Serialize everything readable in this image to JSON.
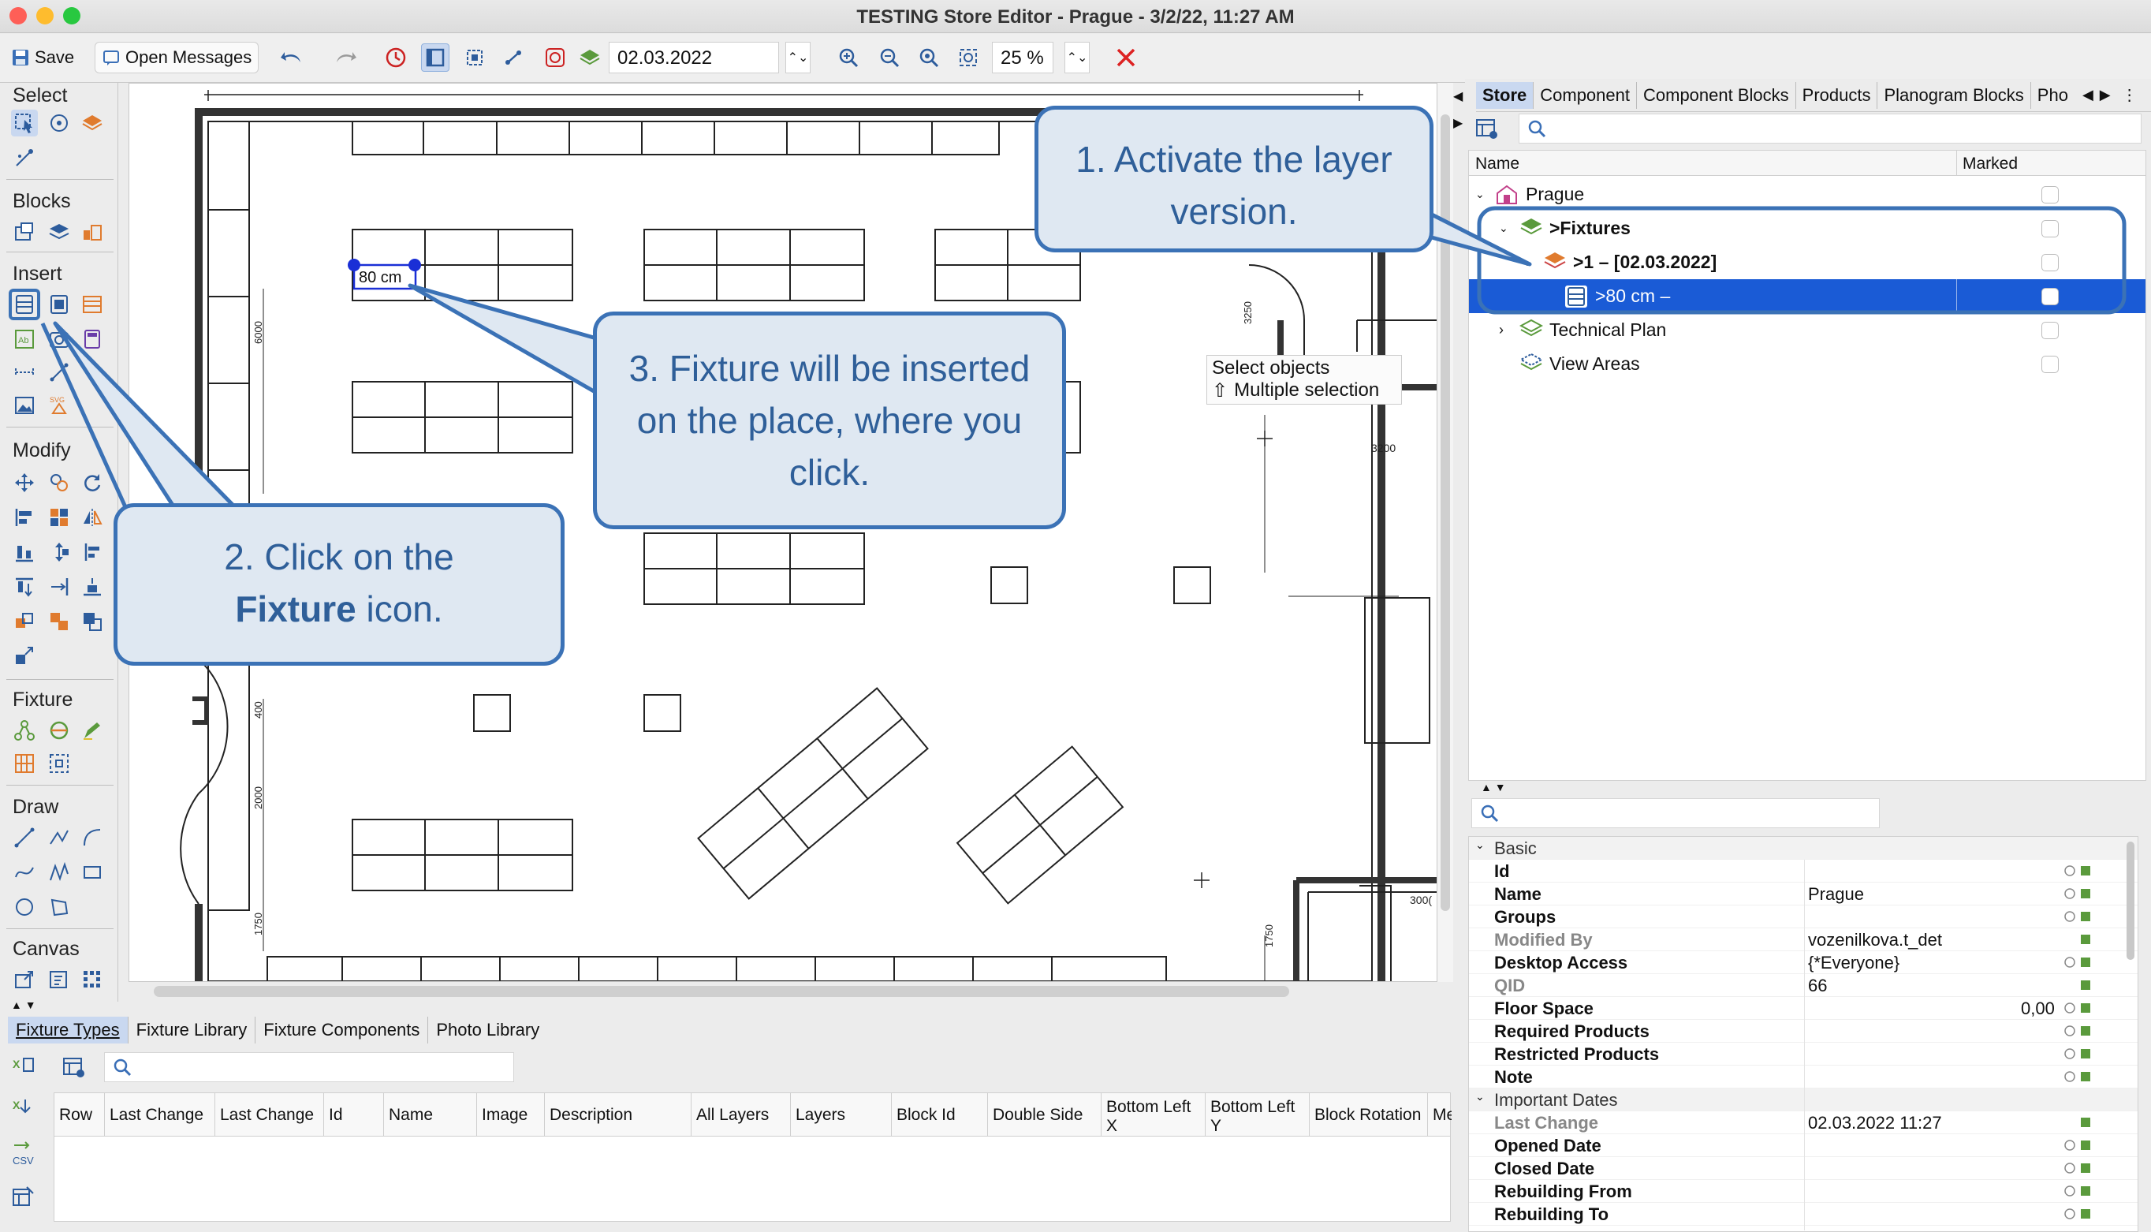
{
  "window": {
    "title": "TESTING Store Editor - Prague - 3/2/22, 11:27 AM"
  },
  "toolbar": {
    "save_label": "Save",
    "open_messages_label": "Open Messages",
    "date_value": "02.03.2022",
    "zoom_value": "25 %"
  },
  "palette": {
    "select": "Select",
    "blocks": "Blocks",
    "insert": "Insert",
    "modify": "Modify",
    "fixture": "Fixture",
    "draw": "Draw",
    "canvas": "Canvas"
  },
  "canvas": {
    "selected_label": "80 cm",
    "tooltip_line1": "Select objects",
    "tooltip_line2": "Multiple selection",
    "dim_6000": "6000",
    "dim_3250": "3250",
    "dim_3200": "3200",
    "dim_400": "400",
    "dim_2000": "2000",
    "dim_1750a": "1750",
    "dim_1750b": "1750",
    "dim_3000": "300("
  },
  "callouts": {
    "c1": "1. Activate the layer version.",
    "c2_pre": "2. Click on the",
    "c2_bold": "Fixture",
    "c2_post": "icon.",
    "c3": "3. Fixture will be inserted on the place, where you click."
  },
  "right_tabs": [
    "Store",
    "Component",
    "Component Blocks",
    "Products",
    "Planogram Blocks",
    "Pho"
  ],
  "tree": {
    "col_name": "Name",
    "col_marked": "Marked",
    "rows": [
      {
        "label": "Prague"
      },
      {
        "label": ">Fixtures"
      },
      {
        "label": ">1 – [02.03.2022]"
      },
      {
        "label": ">80 cm –"
      },
      {
        "label": "Technical Plan"
      },
      {
        "label": "View Areas"
      }
    ]
  },
  "props": {
    "group_basic": "Basic",
    "id": "Id",
    "name": "Name",
    "name_val": "Prague",
    "groups": "Groups",
    "modified_by": "Modified By",
    "modified_by_val": "vozenilkova.t_det",
    "desktop_access": "Desktop Access",
    "desktop_access_val": "{*Everyone}",
    "qid": "QID",
    "qid_val": "66",
    "floor_space": "Floor Space",
    "floor_space_val": "0,00",
    "required_products": "Required Products",
    "restricted_products": "Restricted Products",
    "note": "Note",
    "group_dates": "Important Dates",
    "last_change": "Last Change",
    "last_change_val": "02.03.2022 11:27",
    "opened_date": "Opened Date",
    "closed_date": "Closed Date",
    "rebuilding_from": "Rebuilding From",
    "rebuilding_to": "Rebuilding To"
  },
  "bottom_tabs": [
    "Fixture Types",
    "Fixture Library",
    "Fixture Components",
    "Photo Library"
  ],
  "grid_columns": [
    "Row",
    "Last Change",
    "Last Change",
    "Id",
    "Name",
    "Image",
    "Description",
    "All Layers",
    "Layers",
    "Block Id",
    "Double Side",
    "Bottom Left X",
    "Bottom Left Y",
    "Block Rotation",
    "Me"
  ],
  "colors": {
    "accent": "#3b72b6",
    "selection": "#1a5bd6",
    "callout_fill": "#dfe8f2"
  }
}
